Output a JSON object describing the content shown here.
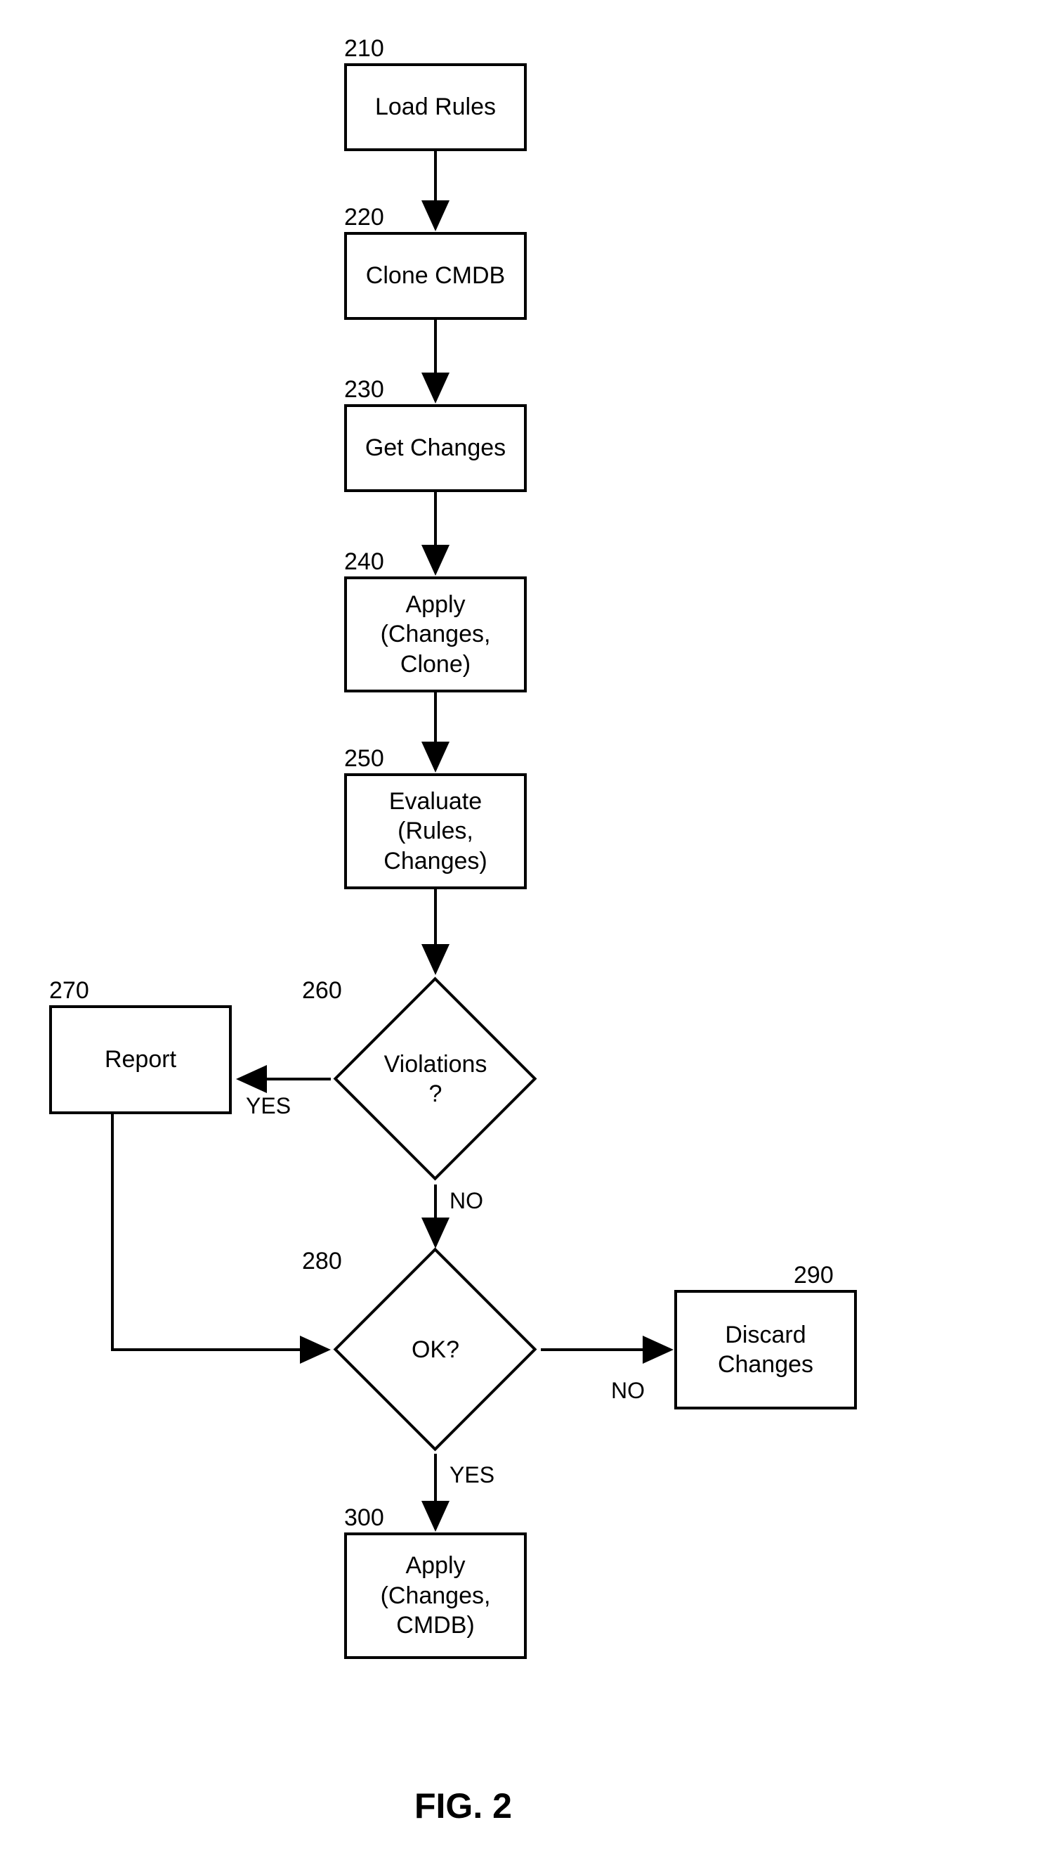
{
  "figure_label": "FIG. 2",
  "boxes": {
    "b210": {
      "num": "210",
      "text": "Load Rules"
    },
    "b220": {
      "num": "220",
      "text": "Clone CMDB"
    },
    "b230": {
      "num": "230",
      "text": "Get Changes"
    },
    "b240": {
      "num": "240",
      "text": "Apply\n(Changes,\nClone)"
    },
    "b250": {
      "num": "250",
      "text": "Evaluate\n(Rules,\nChanges)"
    },
    "b270": {
      "num": "270",
      "text": "Report"
    },
    "b290": {
      "num": "290",
      "text": "Discard\nChanges"
    },
    "b300": {
      "num": "300",
      "text": "Apply\n(Changes,\nCMDB)"
    }
  },
  "decisions": {
    "d260": {
      "num": "260",
      "text": "Violations\n?",
      "yes": "YES",
      "no": "NO"
    },
    "d280": {
      "num": "280",
      "text": "OK?",
      "yes": "YES",
      "no": "NO"
    }
  }
}
